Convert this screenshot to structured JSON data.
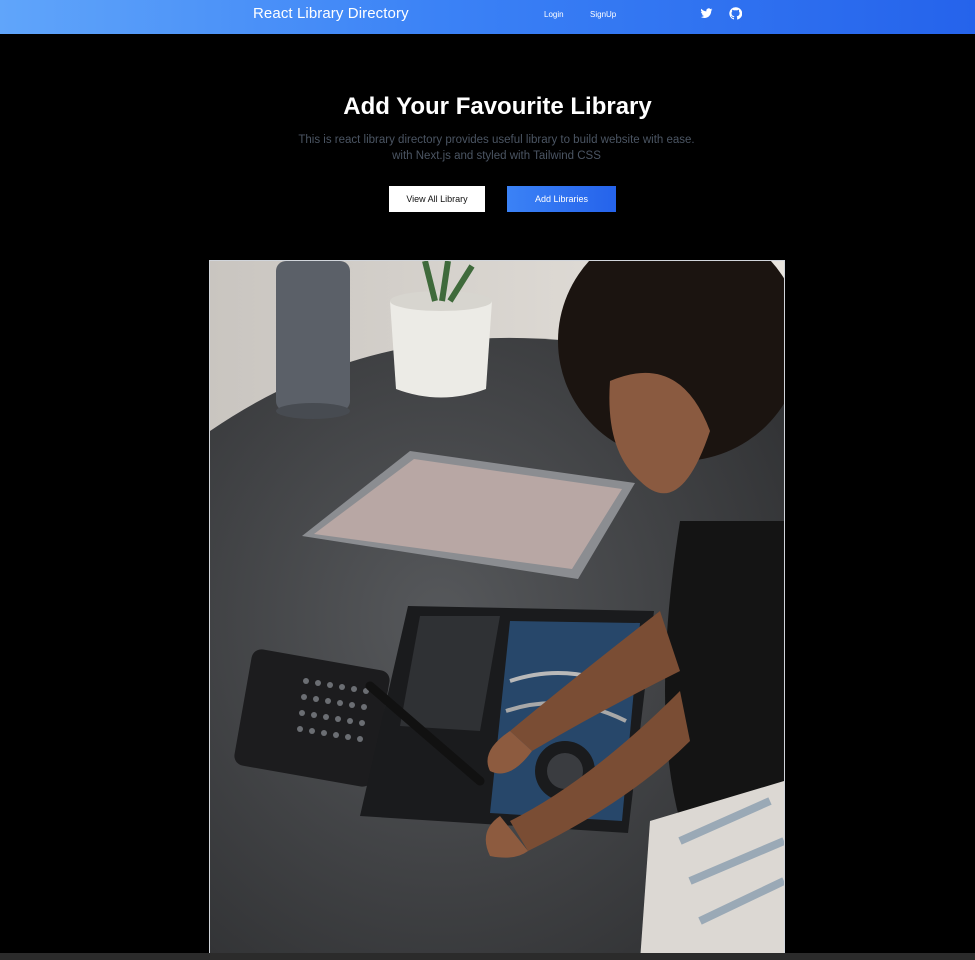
{
  "navbar": {
    "brand": "React Library Directory",
    "links": {
      "login": "Login",
      "signup": "SignUp"
    },
    "icons": {
      "twitter": "twitter-icon",
      "github": "github-icon"
    },
    "gradient": [
      "#60a5fa",
      "#2563eb"
    ]
  },
  "hero": {
    "title": "Add Your Favourite Library",
    "description_line1": "This is react library directory provides useful library to build website with ease.",
    "description_line2": "with Next.js and styled with Tailwind CSS",
    "buttons": {
      "view_all": "View All Library",
      "add": "Add Libraries"
    }
  },
  "colors": {
    "background": "#000000",
    "accent": "#3b82f6",
    "muted_text": "#4b5563"
  }
}
